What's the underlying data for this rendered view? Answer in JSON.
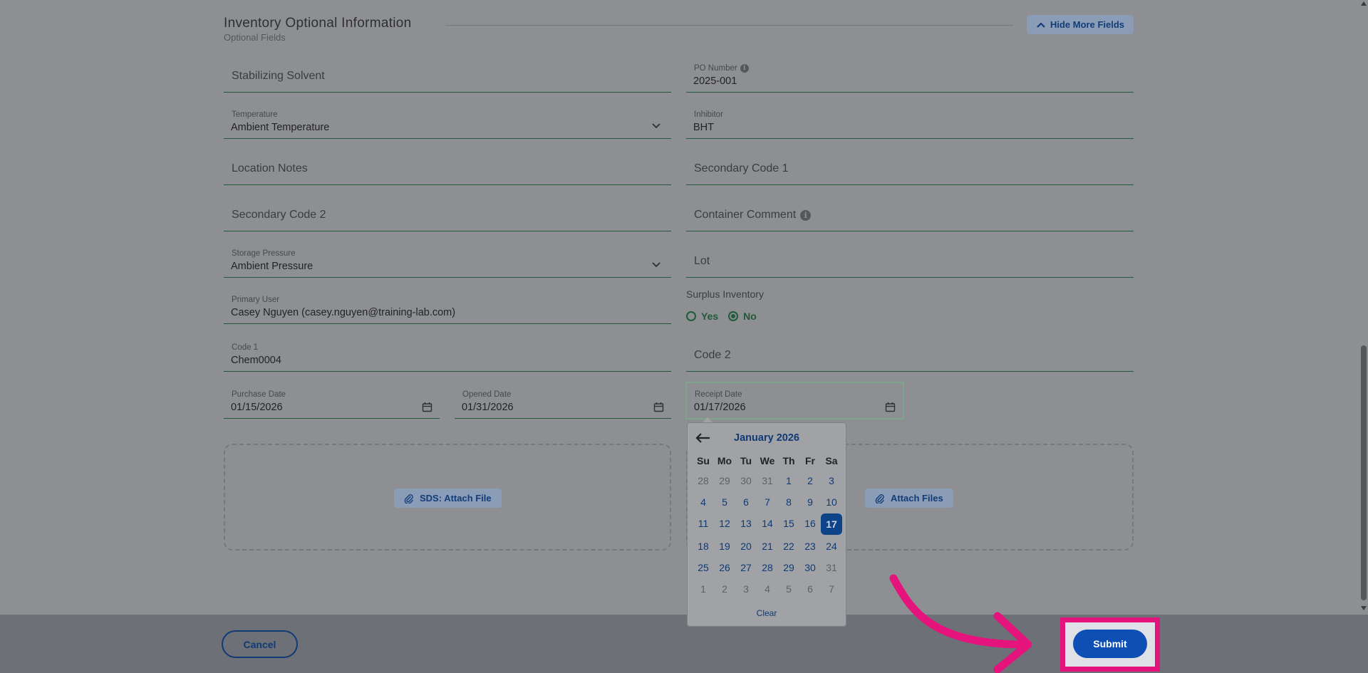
{
  "section": {
    "title": "Inventory Optional Information",
    "subtitle": "Optional Fields",
    "hide_button": "Hide More Fields"
  },
  "fields": {
    "stabilizing_solvent": "Stabilizing Solvent",
    "po_number_label": "PO Number",
    "po_number_value": "2025-001",
    "temperature_label": "Temperature",
    "temperature_value": "Ambient Temperature",
    "inhibitor_label": "Inhibitor",
    "inhibitor_value": "BHT",
    "location_notes": "Location Notes",
    "secondary_code_1": "Secondary Code 1",
    "secondary_code_2": "Secondary Code 2",
    "container_comment": "Container Comment",
    "storage_pressure_label": "Storage Pressure",
    "storage_pressure_value": "Ambient Pressure",
    "lot": "Lot",
    "primary_user_label": "Primary User",
    "primary_user_value": "Casey Nguyen (casey.nguyen@training-lab.com)",
    "surplus_label": "Surplus Inventory",
    "surplus_yes": "Yes",
    "surplus_no": "No",
    "surplus_selected": "No",
    "code1_label": "Code 1",
    "code1_value": "Chem0004",
    "code2": "Code 2",
    "purchase_date_label": "Purchase Date",
    "purchase_date_value": "01/15/2026",
    "opened_date_label": "Opened Date",
    "opened_date_value": "01/31/2026",
    "receipt_date_label": "Receipt Date",
    "receipt_date_value": "01/17/2026"
  },
  "attachments": {
    "sds_button": "SDS: Attach File",
    "files_button": "Attach Files"
  },
  "datepicker": {
    "month_title": "January 2026",
    "weekdays": [
      "Su",
      "Mo",
      "Tu",
      "We",
      "Th",
      "Fr",
      "Sa"
    ],
    "days": [
      {
        "d": "28",
        "muted": true
      },
      {
        "d": "29",
        "muted": true
      },
      {
        "d": "30",
        "muted": true
      },
      {
        "d": "31",
        "muted": true
      },
      {
        "d": "1"
      },
      {
        "d": "2"
      },
      {
        "d": "3"
      },
      {
        "d": "4"
      },
      {
        "d": "5"
      },
      {
        "d": "6"
      },
      {
        "d": "7"
      },
      {
        "d": "8"
      },
      {
        "d": "9"
      },
      {
        "d": "10"
      },
      {
        "d": "11"
      },
      {
        "d": "12"
      },
      {
        "d": "13"
      },
      {
        "d": "14"
      },
      {
        "d": "15"
      },
      {
        "d": "16"
      },
      {
        "d": "17",
        "selected": true
      },
      {
        "d": "18"
      },
      {
        "d": "19"
      },
      {
        "d": "20"
      },
      {
        "d": "21"
      },
      {
        "d": "22"
      },
      {
        "d": "23"
      },
      {
        "d": "24"
      },
      {
        "d": "25"
      },
      {
        "d": "26"
      },
      {
        "d": "27"
      },
      {
        "d": "28"
      },
      {
        "d": "29"
      },
      {
        "d": "30"
      },
      {
        "d": "31",
        "muted": true
      },
      {
        "d": "1",
        "muted": true
      },
      {
        "d": "2",
        "muted": true
      },
      {
        "d": "3",
        "muted": true
      },
      {
        "d": "4",
        "muted": true
      },
      {
        "d": "5",
        "muted": true
      },
      {
        "d": "6",
        "muted": true
      },
      {
        "d": "7",
        "muted": true
      }
    ],
    "clear_label": "Clear"
  },
  "footer": {
    "cancel_label": "Cancel",
    "submit_label": "Submit"
  },
  "colors": {
    "accent_blue": "#0d4fb5",
    "highlight_pink": "#e5137c",
    "field_underline": "#1f5a3a"
  }
}
